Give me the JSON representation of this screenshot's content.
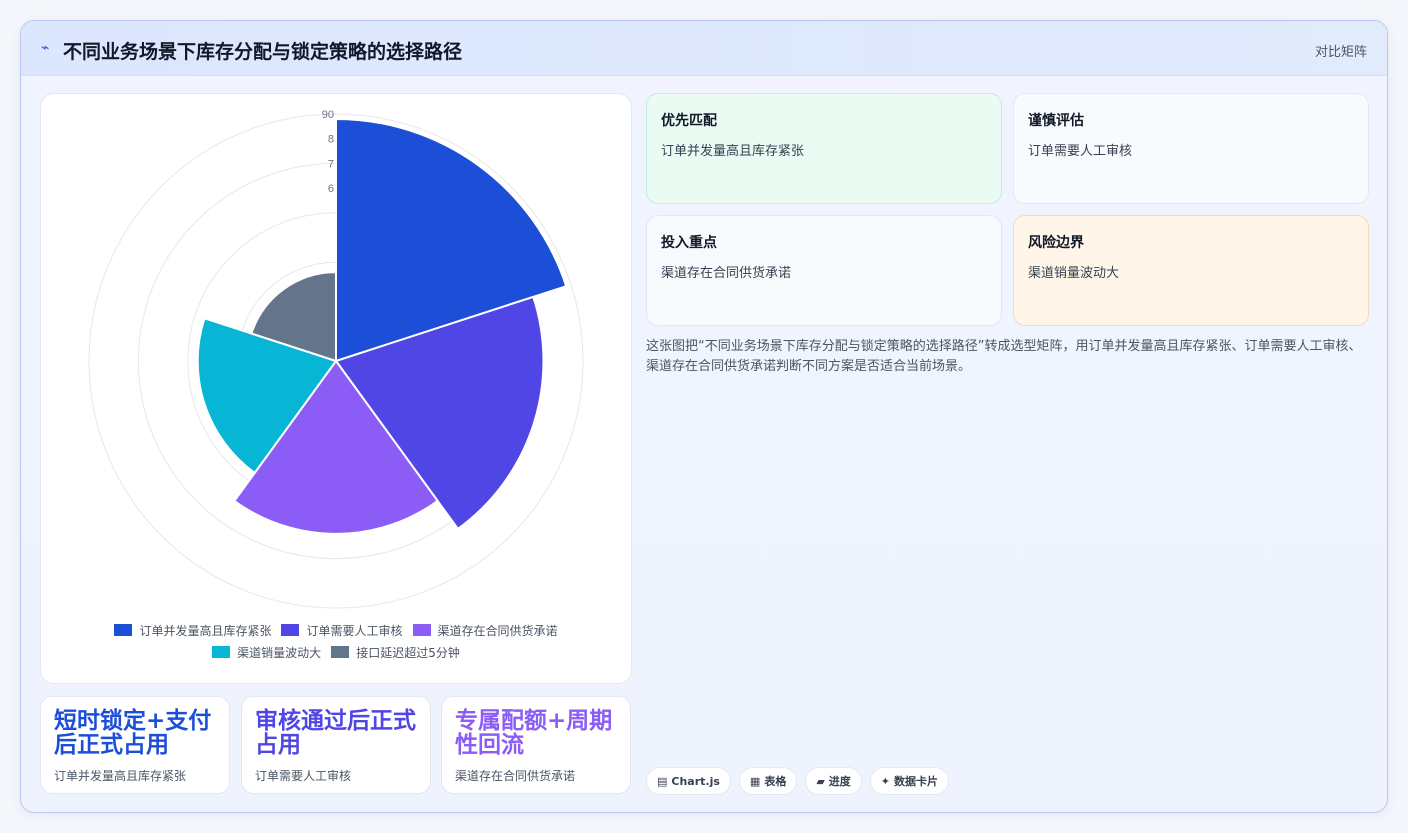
{
  "header": {
    "icon": "trend-line-icon",
    "title": "不同业务场景下库存分配与锁定策略的选择路径",
    "mode_label": "对比矩阵"
  },
  "chart_data": {
    "type": "polarArea",
    "categories": [
      "订单并发量高且库存紧张",
      "订单需要人工审核",
      "渠道存在合同供货承诺",
      "渠道销量波动大",
      "接口延迟超过5分钟"
    ],
    "values": [
      89,
      82,
      75,
      68,
      58
    ],
    "colors": [
      "#1d4ed8",
      "#4f46e5",
      "#8b5cf6",
      "#06b6d4",
      "#64748b"
    ],
    "r_ticks": [
      "90",
      "8",
      "7",
      "6"
    ],
    "r_max": 90,
    "legend_position": "bottom"
  },
  "kpis": [
    {
      "title": "短时锁定+支付后正式占用",
      "sub": "订单并发量高且库存紧张",
      "color": "#1d4ed8"
    },
    {
      "title": "审核通过后正式占用",
      "sub": "订单需要人工审核",
      "color": "#4f46e5"
    },
    {
      "title": "专属配额+周期性回流",
      "sub": "渠道存在合同供货承诺",
      "color": "#8b5cf6"
    }
  ],
  "cards": [
    {
      "title": "优先匹配",
      "desc": "订单并发量高且库存紧张"
    },
    {
      "title": "谨慎评估",
      "desc": "订单需要人工审核"
    },
    {
      "title": "投入重点",
      "desc": "渠道存在合同供货承诺"
    },
    {
      "title": "风险边界",
      "desc": "渠道销量波动大"
    }
  ],
  "description": "这张图把“不同业务场景下库存分配与锁定策略的选择路径”转成选型矩阵，用订单并发量高且库存紧张、订单需要人工审核、渠道存在合同供货承诺判断不同方案是否适合当前场景。",
  "chips": [
    {
      "icon": "chart-icon",
      "glyph": "▤",
      "label": "Chart.js"
    },
    {
      "icon": "table-icon",
      "glyph": "▦",
      "label": "表格"
    },
    {
      "icon": "progress-icon",
      "glyph": "▰",
      "label": "进度"
    },
    {
      "icon": "sparkle-icon",
      "glyph": "✦",
      "label": "数据卡片"
    }
  ]
}
